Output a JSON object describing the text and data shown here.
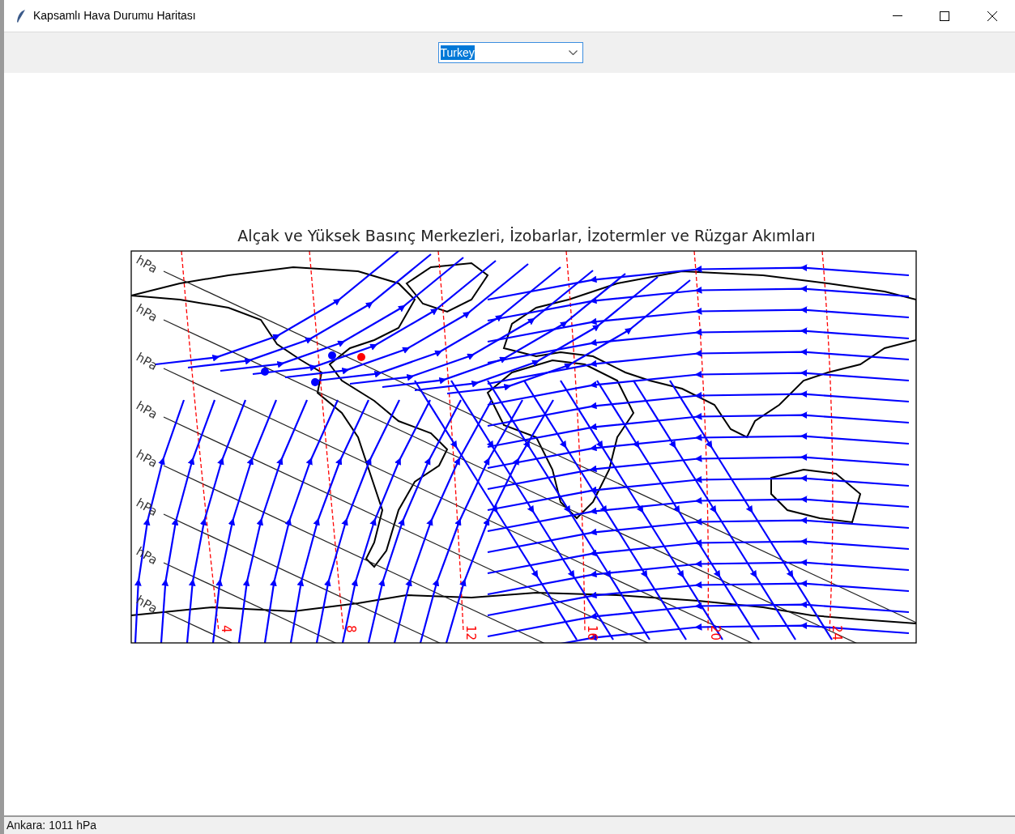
{
  "window": {
    "title": "Kapsamlı Hava Durumu Haritası"
  },
  "country_select": {
    "value": "Turkey"
  },
  "figure": {
    "title": "Alçak ve Yüksek Basınç Merkezleri, İzobarlar, İzotermler ve Rüzgar Akımları",
    "isobar_labels": [
      "hPa",
      "hPa",
      "hPa",
      "hPa",
      "hPa",
      "hPa",
      "hPa",
      "hPa"
    ],
    "isotherm_labels": [
      "4",
      "8",
      "12",
      "16",
      "20",
      "24"
    ]
  },
  "status_bar": {
    "text": "Ankara: 1011 hPa"
  }
}
